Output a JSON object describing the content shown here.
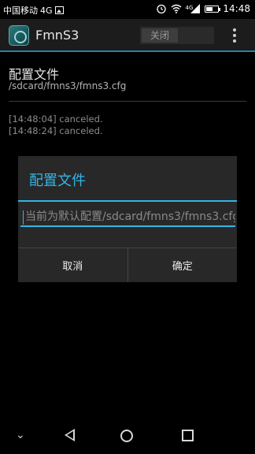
{
  "status_bar": {
    "carrier": "中国移动",
    "network": "4G",
    "network_small": "4G",
    "time": "14:48",
    "battery_level": 0.55
  },
  "action_bar": {
    "app_title": "FmnS3",
    "toggle_label": "关闭"
  },
  "preference": {
    "title": "配置文件",
    "summary": "/sdcard/fmns3/fmns3.cfg"
  },
  "log_lines": [
    "[14:48:04] canceled.",
    "[14:48:24] canceled."
  ],
  "dialog": {
    "title": "配置文件",
    "input_placeholder": "当前为默认配置/sdcard/fmns3/fmns3.cfg",
    "cancel_label": "取消",
    "ok_label": "确定"
  },
  "nav_bar": {
    "down_glyph": "⌄"
  },
  "colors": {
    "accent": "#33b5e5",
    "action_bar_underline": "#2a7fa0"
  }
}
